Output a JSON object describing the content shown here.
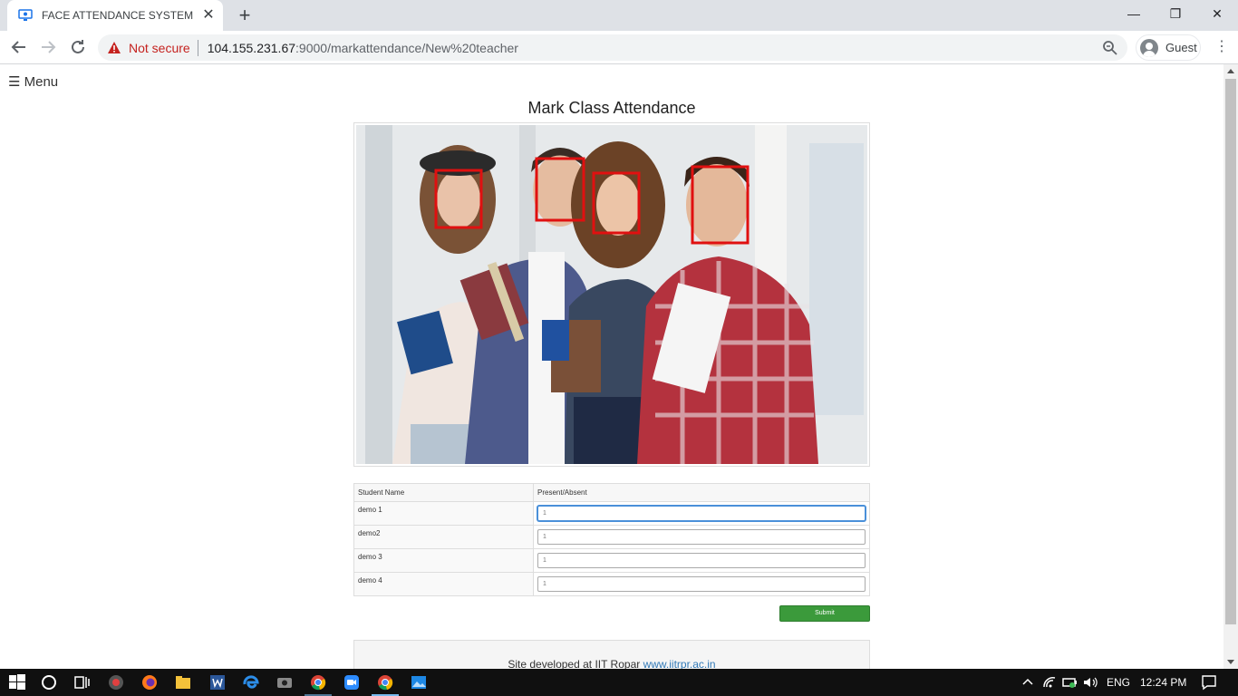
{
  "browser": {
    "tab_title": "FACE ATTENDANCE SYSTEM",
    "security_label": "Not secure",
    "url_host": "104.155.231.67",
    "url_path": ":9000/markattendance/New%20teacher",
    "profile_label": "Guest"
  },
  "page": {
    "menu_label": "☰ Menu",
    "title": "Mark Class Attendance",
    "table": {
      "headers": [
        "Student Name",
        "Present/Absent"
      ],
      "rows": [
        {
          "name": "demo 1",
          "value": "1"
        },
        {
          "name": "demo2",
          "value": "1"
        },
        {
          "name": "demo 3",
          "value": "1"
        },
        {
          "name": "demo 4",
          "value": "1"
        }
      ]
    },
    "submit_label": "Submit",
    "footer_text": "Site developed at IIT Ropar ",
    "footer_link": "www.iitrpr.ac.in"
  },
  "taskbar": {
    "lang": "ENG",
    "time": "12:24 PM"
  },
  "colors": {
    "face_box": "#e01010",
    "submit_bg": "#3b9a3b",
    "accent": "#76b9ed"
  }
}
